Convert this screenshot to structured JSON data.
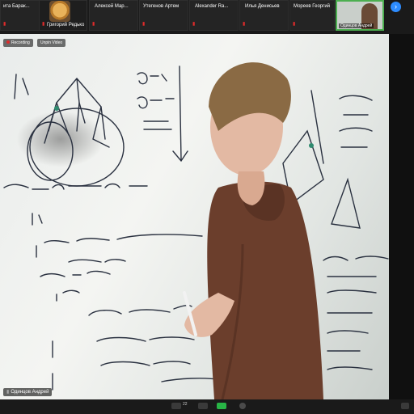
{
  "participants": [
    {
      "name": "ита Барак..."
    },
    {
      "name": "Алексей Мар..."
    },
    {
      "name": "Утегенов Артем"
    },
    {
      "name": "Alexander Ra..."
    },
    {
      "name": "Илья Денисьев"
    },
    {
      "name": "Мореев Георгий"
    }
  ],
  "avatar_participant": {
    "name": "Григорий Редько"
  },
  "self_view": {
    "name": "Одинцов Андрей"
  },
  "main_video": {
    "recording_label": "Recording",
    "stop_video_label": "Unpin Video",
    "speaker_name": "Одинцов Андрей"
  },
  "toolbar": {
    "participants_count": "22"
  },
  "colors": {
    "accent": "#2d8cff",
    "active_speaker": "#4caf50",
    "muted": "#e02b2b"
  }
}
